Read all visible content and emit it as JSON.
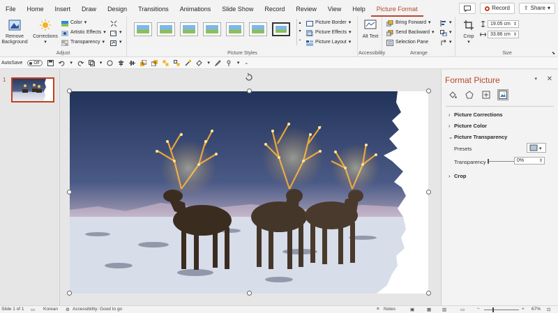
{
  "menu": {
    "tabs": [
      "File",
      "Home",
      "Insert",
      "Draw",
      "Design",
      "Transitions",
      "Animations",
      "Slide Show",
      "Record",
      "Review",
      "View",
      "Help",
      "Picture Format"
    ],
    "active_tab": "Picture Format",
    "record_label": "Record",
    "share_label": "Share"
  },
  "ribbon": {
    "adjust": {
      "label": "Adjust",
      "remove_background": "Remove Background",
      "corrections": "Corrections",
      "color": "Color",
      "artistic_effects": "Artistic Effects",
      "transparency": "Transparency"
    },
    "picture_styles": {
      "label": "Picture Styles",
      "border": "Picture Border",
      "effects": "Picture Effects",
      "layout": "Picture Layout"
    },
    "accessibility": {
      "label": "Accessibility",
      "alt_text": "Alt Text"
    },
    "arrange": {
      "label": "Arrange",
      "bring_forward": "Bring Forward",
      "send_backward": "Send Backward",
      "selection_pane": "Selection Pane"
    },
    "size": {
      "label": "Size",
      "crop": "Crop",
      "height": "19.05 cm",
      "width": "33.86 cm"
    }
  },
  "qat": {
    "autosave_label": "AutoSave",
    "autosave_state": "Off"
  },
  "thumbnails": {
    "slide_number": "1"
  },
  "format_pane": {
    "title": "Format Picture",
    "sections": {
      "corrections": "Picture Corrections",
      "color": "Picture Color",
      "transparency": "Picture Transparency",
      "crop": "Crop"
    },
    "presets_label": "Presets",
    "transparency_label": "Transparency",
    "transparency_value": "0%"
  },
  "status": {
    "slide_info": "Slide 1 of 1",
    "language": "Korean",
    "accessibility": "Accessibility: Good to go",
    "notes": "Notes",
    "zoom": "67%"
  },
  "colors": {
    "accent": "#B7472A",
    "record": "#C43E1C"
  }
}
